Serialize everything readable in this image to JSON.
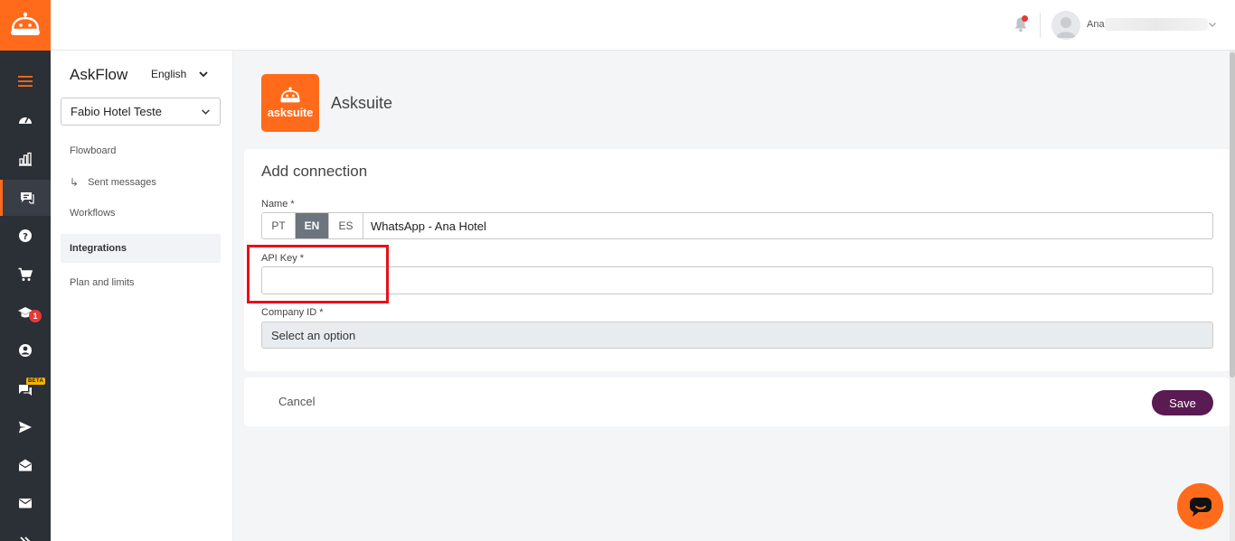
{
  "topbar": {
    "user_name": "Ana"
  },
  "subnav": {
    "app_title": "AskFlow",
    "language": "English",
    "hotel": "Fabio Hotel Teste",
    "items": [
      {
        "label": "Flowboard"
      },
      {
        "label": "Sent messages"
      },
      {
        "label": "Workflows"
      },
      {
        "label": "Integrations"
      },
      {
        "label": "Plan and limits"
      }
    ]
  },
  "rail": {
    "badge_count": "1",
    "beta_label": "BETA"
  },
  "integration": {
    "logo_text": "asksuite",
    "name": "Asksuite"
  },
  "form": {
    "title": "Add connection",
    "name_label": "Name *",
    "lang_tabs": [
      "PT",
      "EN",
      "ES"
    ],
    "name_value": "WhatsApp - Ana Hotel",
    "api_key_label": "API Key *",
    "api_key_value": "",
    "company_label": "Company ID *",
    "company_value": "Select an option"
  },
  "actions": {
    "cancel": "Cancel",
    "save": "Save"
  },
  "colors": {
    "brand_orange": "#ff6b1a",
    "save_purple": "#5a1a52",
    "highlight_red": "#e8101b",
    "rail_dark": "#2b2f36"
  }
}
